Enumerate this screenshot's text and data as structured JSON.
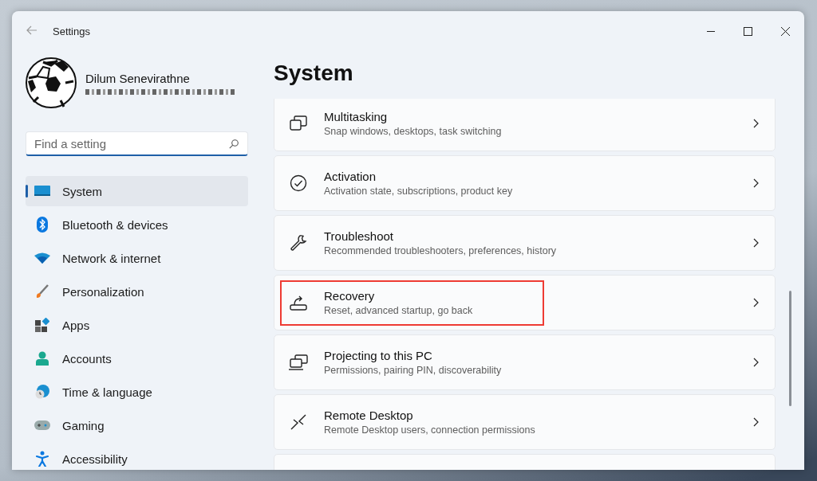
{
  "window": {
    "title": "Settings"
  },
  "profile": {
    "name": "Dilum Senevirathne"
  },
  "search": {
    "placeholder": "Find a setting"
  },
  "sidebar": {
    "items": [
      {
        "label": "System",
        "selected": true
      },
      {
        "label": "Bluetooth & devices",
        "selected": false
      },
      {
        "label": "Network & internet",
        "selected": false
      },
      {
        "label": "Personalization",
        "selected": false
      },
      {
        "label": "Apps",
        "selected": false
      },
      {
        "label": "Accounts",
        "selected": false
      },
      {
        "label": "Time & language",
        "selected": false
      },
      {
        "label": "Gaming",
        "selected": false
      },
      {
        "label": "Accessibility",
        "selected": false
      }
    ]
  },
  "page_title": "System",
  "cards": [
    {
      "title": "Multitasking",
      "subtitle": "Snap windows, desktops, task switching",
      "highlighted": false
    },
    {
      "title": "Activation",
      "subtitle": "Activation state, subscriptions, product key",
      "highlighted": false
    },
    {
      "title": "Troubleshoot",
      "subtitle": "Recommended troubleshooters, preferences, history",
      "highlighted": false
    },
    {
      "title": "Recovery",
      "subtitle": "Reset, advanced startup, go back",
      "highlighted": true
    },
    {
      "title": "Projecting to this PC",
      "subtitle": "Permissions, pairing PIN, discoverability",
      "highlighted": false
    },
    {
      "title": "Remote Desktop",
      "subtitle": "Remote Desktop users, connection permissions",
      "highlighted": false
    }
  ]
}
